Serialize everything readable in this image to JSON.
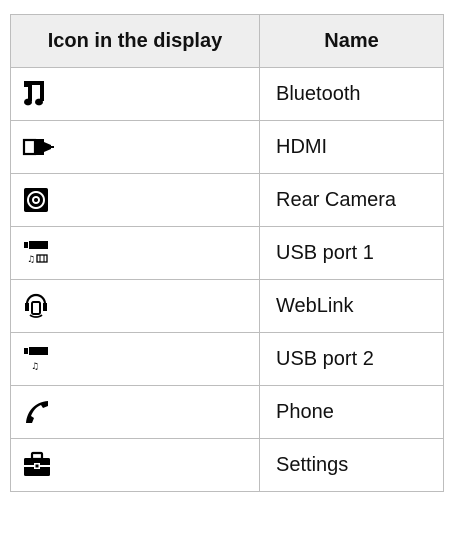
{
  "table": {
    "headers": [
      "Icon in the display",
      "Name"
    ],
    "rows": [
      {
        "icon": "music-note-icon",
        "name": "Bluetooth"
      },
      {
        "icon": "hdmi-plug-icon",
        "name": "HDMI"
      },
      {
        "icon": "rear-camera-icon",
        "name": "Rear Camera"
      },
      {
        "icon": "usb-media-video-icon",
        "name": "USB port 1"
      },
      {
        "icon": "weblink-icon",
        "name": "WebLink"
      },
      {
        "icon": "usb-media-icon",
        "name": "USB port 2"
      },
      {
        "icon": "phone-handset-icon",
        "name": "Phone"
      },
      {
        "icon": "toolbox-icon",
        "name": "Settings"
      }
    ]
  },
  "colors": {
    "header_bg": "#eeeeee",
    "border": "#bdbdbd",
    "icon": "#000000"
  }
}
